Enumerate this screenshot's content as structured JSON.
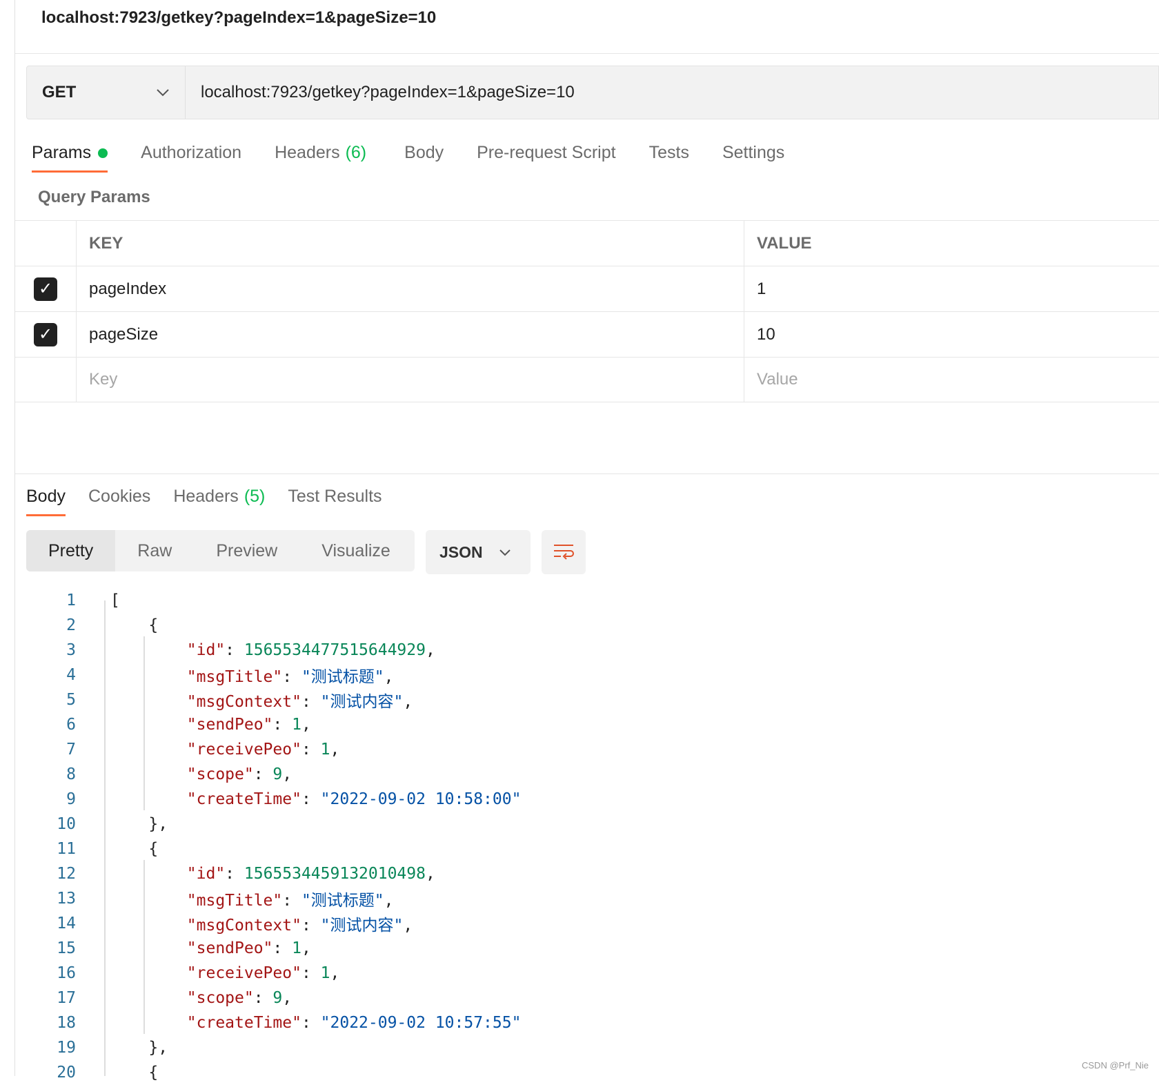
{
  "title": "localhost:7923/getkey?pageIndex=1&pageSize=10",
  "request": {
    "method": "GET",
    "url": "localhost:7923/getkey?pageIndex=1&pageSize=10"
  },
  "request_tabs": [
    {
      "label": "Params",
      "dot": true
    },
    {
      "label": "Authorization"
    },
    {
      "label": "Headers",
      "count": "(6)"
    },
    {
      "label": "Body"
    },
    {
      "label": "Pre-request Script"
    },
    {
      "label": "Tests"
    },
    {
      "label": "Settings"
    }
  ],
  "query_params": {
    "title": "Query Params",
    "headers": {
      "key": "KEY",
      "value": "VALUE"
    },
    "rows": [
      {
        "checked": true,
        "key": "pageIndex",
        "value": "1"
      },
      {
        "checked": true,
        "key": "pageSize",
        "value": "10"
      }
    ],
    "placeholders": {
      "key": "Key",
      "value": "Value"
    }
  },
  "response_tabs": [
    {
      "label": "Body"
    },
    {
      "label": "Cookies"
    },
    {
      "label": "Headers",
      "count": "(5)"
    },
    {
      "label": "Test Results"
    }
  ],
  "view_modes": [
    "Pretty",
    "Raw",
    "Preview",
    "Visualize"
  ],
  "format": "JSON",
  "colors": {
    "accent": "#ff6c37",
    "success": "#0cbb52",
    "key": "#a31515",
    "number": "#098658",
    "string": "#0451a5"
  },
  "code_lines": [
    [
      {
        "t": "[",
        "c": "p"
      }
    ],
    [
      {
        "t": "    {",
        "c": "p"
      }
    ],
    [
      {
        "t": "        \"id\"",
        "c": "k"
      },
      {
        "t": ": ",
        "c": "p"
      },
      {
        "t": "1565534477515644929",
        "c": "n"
      },
      {
        "t": ",",
        "c": "p"
      }
    ],
    [
      {
        "t": "        \"msgTitle\"",
        "c": "k"
      },
      {
        "t": ": ",
        "c": "p"
      },
      {
        "t": "\"测试标题\"",
        "c": "s"
      },
      {
        "t": ",",
        "c": "p"
      }
    ],
    [
      {
        "t": "        \"msgContext\"",
        "c": "k"
      },
      {
        "t": ": ",
        "c": "p"
      },
      {
        "t": "\"测试内容\"",
        "c": "s"
      },
      {
        "t": ",",
        "c": "p"
      }
    ],
    [
      {
        "t": "        \"sendPeo\"",
        "c": "k"
      },
      {
        "t": ": ",
        "c": "p"
      },
      {
        "t": "1",
        "c": "n"
      },
      {
        "t": ",",
        "c": "p"
      }
    ],
    [
      {
        "t": "        \"receivePeo\"",
        "c": "k"
      },
      {
        "t": ": ",
        "c": "p"
      },
      {
        "t": "1",
        "c": "n"
      },
      {
        "t": ",",
        "c": "p"
      }
    ],
    [
      {
        "t": "        \"scope\"",
        "c": "k"
      },
      {
        "t": ": ",
        "c": "p"
      },
      {
        "t": "9",
        "c": "n"
      },
      {
        "t": ",",
        "c": "p"
      }
    ],
    [
      {
        "t": "        \"createTime\"",
        "c": "k"
      },
      {
        "t": ": ",
        "c": "p"
      },
      {
        "t": "\"2022-09-02 10:58:00\"",
        "c": "s"
      }
    ],
    [
      {
        "t": "    },",
        "c": "p"
      }
    ],
    [
      {
        "t": "    {",
        "c": "p"
      }
    ],
    [
      {
        "t": "        \"id\"",
        "c": "k"
      },
      {
        "t": ": ",
        "c": "p"
      },
      {
        "t": "1565534459132010498",
        "c": "n"
      },
      {
        "t": ",",
        "c": "p"
      }
    ],
    [
      {
        "t": "        \"msgTitle\"",
        "c": "k"
      },
      {
        "t": ": ",
        "c": "p"
      },
      {
        "t": "\"测试标题\"",
        "c": "s"
      },
      {
        "t": ",",
        "c": "p"
      }
    ],
    [
      {
        "t": "        \"msgContext\"",
        "c": "k"
      },
      {
        "t": ": ",
        "c": "p"
      },
      {
        "t": "\"测试内容\"",
        "c": "s"
      },
      {
        "t": ",",
        "c": "p"
      }
    ],
    [
      {
        "t": "        \"sendPeo\"",
        "c": "k"
      },
      {
        "t": ": ",
        "c": "p"
      },
      {
        "t": "1",
        "c": "n"
      },
      {
        "t": ",",
        "c": "p"
      }
    ],
    [
      {
        "t": "        \"receivePeo\"",
        "c": "k"
      },
      {
        "t": ": ",
        "c": "p"
      },
      {
        "t": "1",
        "c": "n"
      },
      {
        "t": ",",
        "c": "p"
      }
    ],
    [
      {
        "t": "        \"scope\"",
        "c": "k"
      },
      {
        "t": ": ",
        "c": "p"
      },
      {
        "t": "9",
        "c": "n"
      },
      {
        "t": ",",
        "c": "p"
      }
    ],
    [
      {
        "t": "        \"createTime\"",
        "c": "k"
      },
      {
        "t": ": ",
        "c": "p"
      },
      {
        "t": "\"2022-09-02 10:57:55\"",
        "c": "s"
      }
    ],
    [
      {
        "t": "    },",
        "c": "p"
      }
    ],
    [
      {
        "t": "    {",
        "c": "p"
      }
    ]
  ],
  "watermark": "CSDN @Prf_Nie"
}
